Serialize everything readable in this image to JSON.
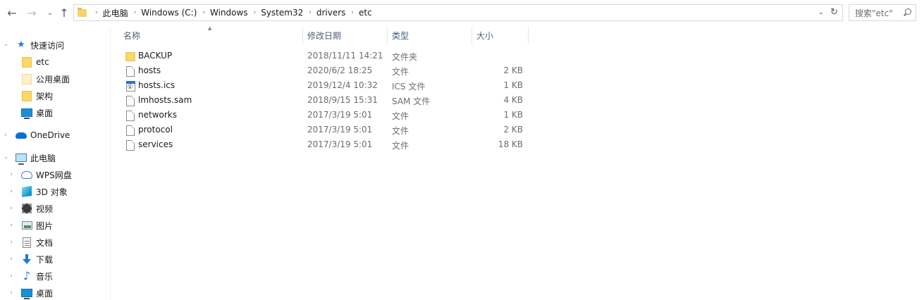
{
  "address_bar": {
    "crumbs": [
      "此电脑",
      "Windows (C:)",
      "Windows",
      "System32",
      "drivers",
      "etc"
    ]
  },
  "search": {
    "placeholder": "搜索\"etc\""
  },
  "nav_pane": {
    "quick_access": {
      "label": "快速访问",
      "icon": "star-icon"
    },
    "quick_items": [
      {
        "label": "etc",
        "icon": "folder-icon"
      },
      {
        "label": "公用桌面",
        "icon": "folder-icon"
      },
      {
        "label": "架构",
        "icon": "folder-icon"
      },
      {
        "label": "桌面",
        "icon": "desktop-icon"
      }
    ],
    "onedrive": {
      "label": "OneDrive",
      "icon": "cloud-icon"
    },
    "this_pc": {
      "label": "此电脑",
      "icon": "computer-icon"
    },
    "pc_items": [
      {
        "label": "WPS网盘",
        "icon": "wps-cloud-icon"
      },
      {
        "label": "3D 对象",
        "icon": "cube-icon"
      },
      {
        "label": "视频",
        "icon": "video-icon"
      },
      {
        "label": "图片",
        "icon": "picture-icon"
      },
      {
        "label": "文档",
        "icon": "document-icon"
      },
      {
        "label": "下载",
        "icon": "download-icon"
      },
      {
        "label": "音乐",
        "icon": "music-icon"
      },
      {
        "label": "桌面",
        "icon": "desktop-icon"
      }
    ]
  },
  "file_list": {
    "columns": {
      "name": "名称",
      "date": "修改日期",
      "type": "类型",
      "size": "大小"
    },
    "rows": [
      {
        "name": "BACKUP",
        "date": "2018/11/11 14:21",
        "type": "文件夹",
        "size": "",
        "icon": "folder-icon"
      },
      {
        "name": "hosts",
        "date": "2020/6/2 18:25",
        "type": "文件",
        "size": "2 KB",
        "icon": "file-icon"
      },
      {
        "name": "hosts.ics",
        "date": "2019/12/4 10:32",
        "type": "ICS 文件",
        "size": "1 KB",
        "icon": "ics-file-icon"
      },
      {
        "name": "lmhosts.sam",
        "date": "2018/9/15 15:31",
        "type": "SAM 文件",
        "size": "4 KB",
        "icon": "file-icon"
      },
      {
        "name": "networks",
        "date": "2017/3/19 5:01",
        "type": "文件",
        "size": "1 KB",
        "icon": "file-icon"
      },
      {
        "name": "protocol",
        "date": "2017/3/19 5:01",
        "type": "文件",
        "size": "2 KB",
        "icon": "file-icon"
      },
      {
        "name": "services",
        "date": "2017/3/19 5:01",
        "type": "文件",
        "size": "18 KB",
        "icon": "file-icon"
      }
    ]
  }
}
